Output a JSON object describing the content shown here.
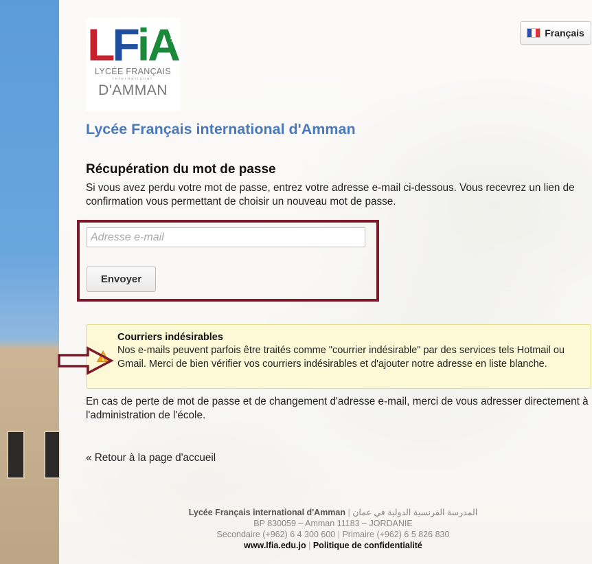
{
  "logo": {
    "letters_l": "L",
    "letters_f": "F",
    "letters_ia": "iA",
    "line1": "LYCÉE FRANÇAIS",
    "line2": "international",
    "line3": "D'AMMAN",
    "colors": {
      "red": "#c8202d",
      "blue": "#1e4e9c",
      "green": "#1a8a3a"
    }
  },
  "language": {
    "label": "Français",
    "flag_icon": "french-flag-icon"
  },
  "site_title": "Lycée Français international d'Amman",
  "recovery": {
    "title": "Récupération du mot de passe",
    "intro": "Si vous avez perdu votre mot de passe, entrez votre adresse e-mail ci-dessous. Vous recevrez un lien de confirmation vous permettant de choisir un nouveau mot de passe.",
    "email_placeholder": "Adresse e-mail",
    "email_value": "",
    "submit_label": "Envoyer"
  },
  "warning": {
    "icon": "warning-icon",
    "title": "Courriers indésirables",
    "text": "Nos e-mails peuvent parfois être traités comme \"courrier indésirable\" par des services tels Hotmail ou Gmail. Merci de bien vérifier vos courriers indésirables et d'ajouter notre adresse en liste blanche."
  },
  "after_text": "En cas de perte de mot de passe et de changement d'adresse e-mail, merci de vous adresser directement à l'administration de l'école.",
  "back_link": "« Retour à la page d'accueil",
  "footer": {
    "school_name": "Lycée Français international d'Amman",
    "school_name_ar": "المدرسة الفرنسية الدولية في عمان",
    "address": "BP 830059 – Amman 11183 – JORDANIE",
    "phone_secondary": "Secondaire (+962) 6 4 300 600",
    "phone_primary": "Primaire (+962) 6 5 826 830",
    "website": "www.lfia.edu.jo",
    "privacy": "Politique de confidentialité"
  },
  "colors": {
    "title_blue": "#4b78b8",
    "highlight_border": "#7b1a2b",
    "warning_bg": "#fdf8d6"
  }
}
